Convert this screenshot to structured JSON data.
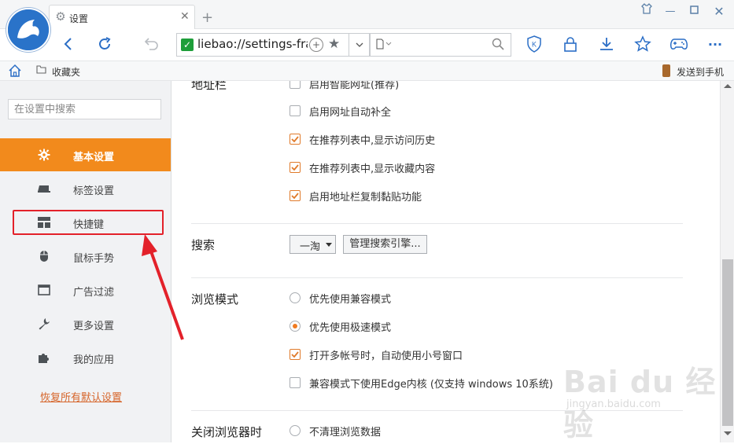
{
  "tab": {
    "title": "设置"
  },
  "address": {
    "url": "liebao://settings-fra"
  },
  "bookmarks": {
    "folder_label": "收藏夹",
    "send_to_phone": "发送到手机"
  },
  "sidebar": {
    "search_placeholder": "在设置中搜索",
    "items": [
      {
        "label": "基本设置",
        "icon": "gear-icon",
        "active": true
      },
      {
        "label": "标签设置",
        "icon": "tab-icon",
        "active": false
      },
      {
        "label": "快捷键",
        "icon": "keyboard-icon",
        "active": false
      },
      {
        "label": "鼠标手势",
        "icon": "mouse-icon",
        "active": false
      },
      {
        "label": "广告过滤",
        "icon": "window-icon",
        "active": false
      },
      {
        "label": "更多设置",
        "icon": "wrench-icon",
        "active": false
      },
      {
        "label": "我的应用",
        "icon": "puzzle-icon",
        "active": false
      }
    ],
    "restore_defaults": "恢复所有默认设置"
  },
  "content": {
    "address_bar": {
      "title": "地址栏",
      "options": [
        {
          "label": "启用智能网址(推荐)",
          "checked": false
        },
        {
          "label": "启用网址自动补全",
          "checked": false
        },
        {
          "label": "在推荐列表中,显示访问历史",
          "checked": true
        },
        {
          "label": "在推荐列表中,显示收藏内容",
          "checked": true
        },
        {
          "label": "启用地址栏复制黏贴功能",
          "checked": true
        }
      ]
    },
    "search": {
      "title": "搜索",
      "engine_value": "一淘",
      "manage_button": "管理搜索引擎..."
    },
    "browse_mode": {
      "title": "浏览模式",
      "radios": [
        {
          "label": "优先使用兼容模式",
          "selected": false
        },
        {
          "label": "优先使用极速模式",
          "selected": true
        }
      ],
      "checkboxes": [
        {
          "label": "打开多帐号时，自动使用小号窗口",
          "checked": true
        },
        {
          "label": "兼容模式下使用Edge内核 (仅支持 windows 10系统)",
          "checked": false
        }
      ]
    },
    "on_close": {
      "title": "关闭浏览器时",
      "radios": [
        {
          "label": "不清理浏览数据",
          "selected": false
        }
      ]
    }
  },
  "watermark": {
    "brand": "Bai du 经验",
    "url": "jingyan.baidu.com"
  },
  "colors": {
    "accent": "#f28a1c",
    "highlight": "#e3212a",
    "link": "#d6652a",
    "toolbar_icon": "#2b6ec6"
  }
}
